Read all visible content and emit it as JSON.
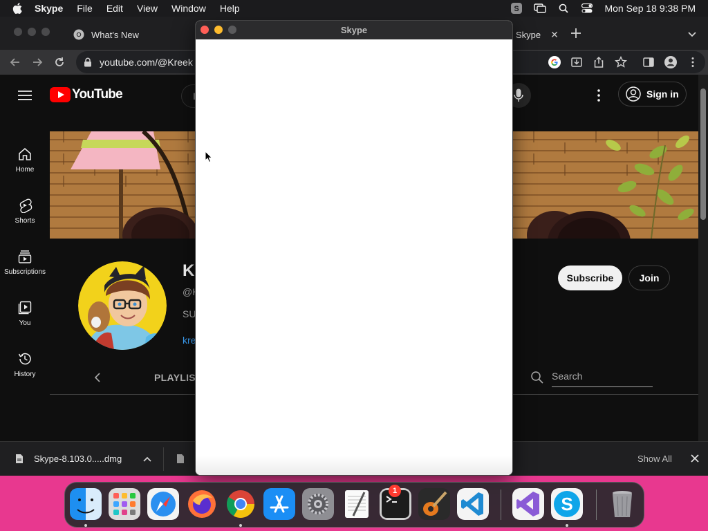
{
  "menubar": {
    "app_name": "Skype",
    "items": [
      "File",
      "Edit",
      "View",
      "Window",
      "Help"
    ],
    "clock": "Mon Sep 18  9:38 PM"
  },
  "browser": {
    "tabs": [
      {
        "label": "What's New"
      },
      {
        "label": "Skype"
      }
    ],
    "url": "youtube.com/@Kreek"
  },
  "youtube": {
    "logo_text": "YouTube",
    "search_partial": "I",
    "sign_in_label": "Sign in",
    "sidebar": [
      {
        "label": "Home",
        "icon": "home-icon"
      },
      {
        "label": "Shorts",
        "icon": "shorts-icon"
      },
      {
        "label": "Subscriptions",
        "icon": "subscriptions-icon"
      },
      {
        "label": "You",
        "icon": "you-icon"
      },
      {
        "label": "History",
        "icon": "history-icon"
      }
    ],
    "channel": {
      "name_partial": "K",
      "handle_partial": "@K",
      "desc_partial": "SU",
      "link_partial": "kree"
    },
    "subscribe_label": "Subscribe",
    "join_label": "Join",
    "tab_playlists": "PLAYLIS",
    "search_placeholder": "Search"
  },
  "downloads": {
    "file_name": "Skype-8.103.0.....dmg",
    "show_all_label": "Show All"
  },
  "skype_window": {
    "title": "Skype"
  },
  "dock": {
    "apps": [
      "Finder",
      "Launchpad",
      "Safari",
      "Firefox",
      "Chrome",
      "App Store",
      "System Settings",
      "TextEdit",
      "Terminal",
      "GarageBand",
      "Visual Studio Code",
      "Visual Studio",
      "Skype",
      "Trash"
    ],
    "settings_badge": "1"
  }
}
